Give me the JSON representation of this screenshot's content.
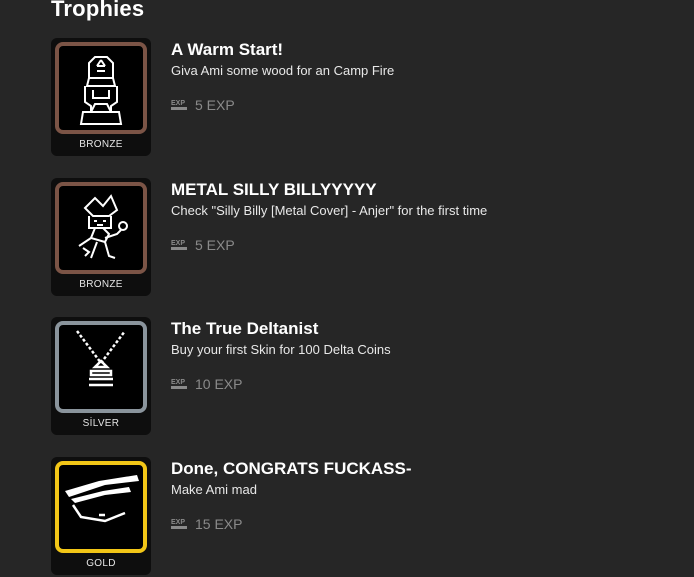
{
  "heading": "Trophies",
  "trophies": [
    {
      "title": "A Warm Start!",
      "description": "Giva Ami some wood for an Camp Fire",
      "exp": "5 EXP",
      "tier": "BRONZE",
      "tier_color": "#7b5446",
      "icon": "hooded-character-icon"
    },
    {
      "title": "METAL SILLY BILLYYYYY",
      "description": "Check \"Silly Billy [Metal Cover] - Anjer\" for the first time",
      "exp": "5 EXP",
      "tier": "BRONZE",
      "tier_color": "#7b5446",
      "icon": "jester-character-icon"
    },
    {
      "title": "The True Deltanist",
      "description": "Buy your first Skin for 100 Delta Coins",
      "exp": "10 EXP",
      "tier": "SİLVER",
      "tier_color": "#8a949c",
      "icon": "necklace-pendant-icon"
    },
    {
      "title": "Done, CONGRATS FUCKASS-",
      "description": "Make Ami mad",
      "exp": "15 EXP",
      "tier": "GOLD",
      "tier_color": "#f2c617",
      "icon": "angry-eye-icon"
    }
  ],
  "exp_icon": "exp-icon"
}
